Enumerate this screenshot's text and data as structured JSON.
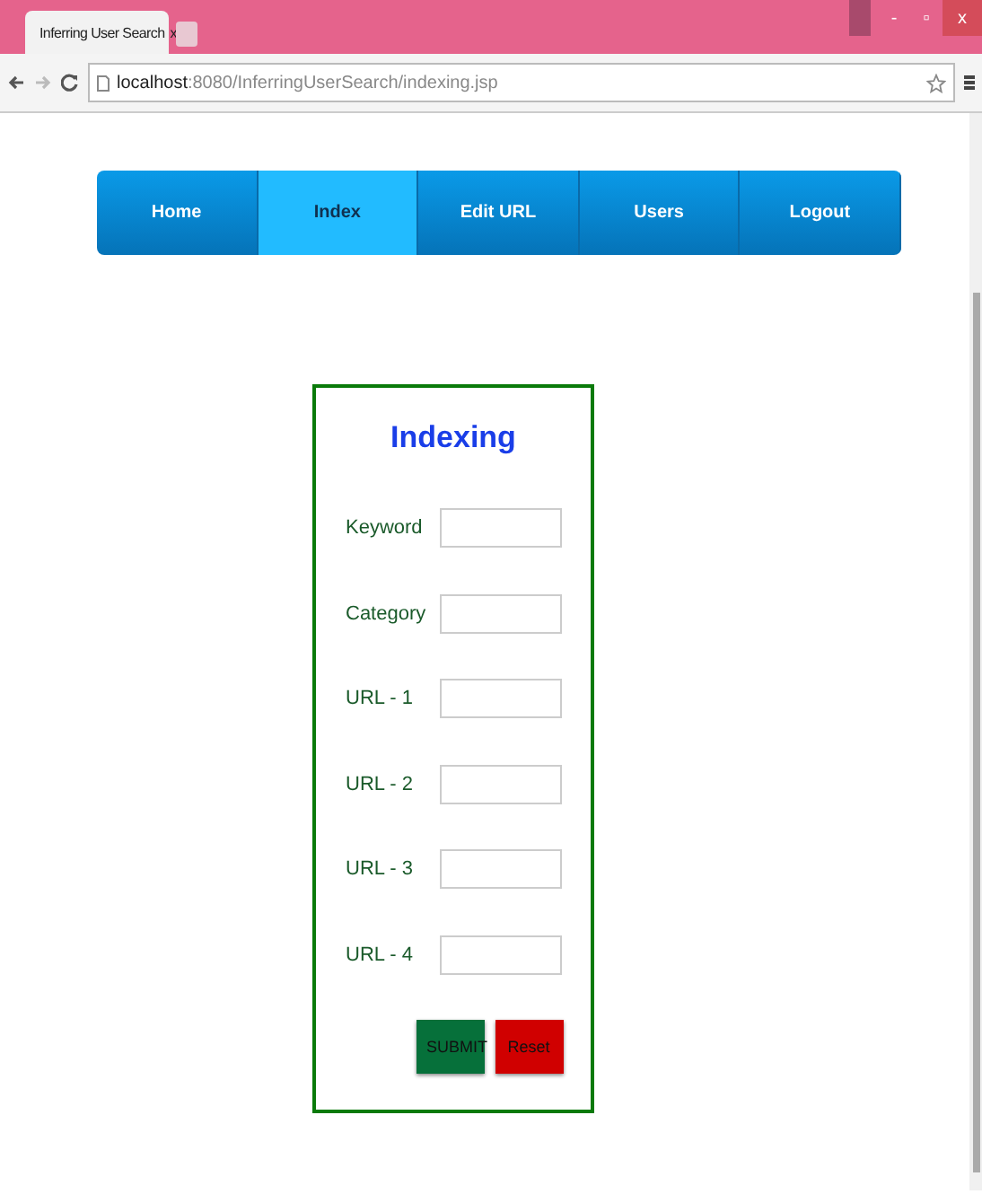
{
  "browser": {
    "tab_title": "Inferring User Search",
    "tab_close": "x",
    "url_host": "localhost",
    "url_path": ":8080/InferringUserSearch/indexing.jsp",
    "window_buttons": [
      "-",
      "▫",
      "x"
    ]
  },
  "nav": [
    {
      "label": "Home",
      "selected": false
    },
    {
      "label": "Index",
      "selected": true
    },
    {
      "label": "Edit URL",
      "selected": false
    },
    {
      "label": "Users",
      "selected": false
    },
    {
      "label": "Logout",
      "selected": false
    }
  ],
  "form": {
    "title": "Indexing",
    "fields": [
      {
        "label": "Keyword"
      },
      {
        "label": "Category"
      },
      {
        "label": "URL - 1"
      },
      {
        "label": "URL - 2"
      },
      {
        "label": "URL - 3"
      },
      {
        "label": "URL - 4"
      }
    ],
    "buttons": [
      {
        "label": "SUBMIT",
        "kind": "submit"
      },
      {
        "label": "Reset",
        "kind": "reset"
      }
    ]
  }
}
